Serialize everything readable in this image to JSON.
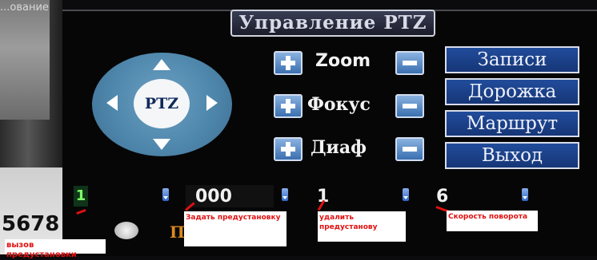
{
  "window": {
    "title": "...ование"
  },
  "left_strip": {
    "number": "5678"
  },
  "panel": {
    "title": "Управление PTZ",
    "joystick": {
      "center_label": "PTZ"
    },
    "controls": [
      {
        "label": "Zoom"
      },
      {
        "label": "Фокус"
      },
      {
        "label": "Диаф"
      }
    ],
    "menu": [
      {
        "label": "Записи"
      },
      {
        "label": "Дорожка"
      },
      {
        "label": "Маршрут"
      },
      {
        "label": "Выход"
      }
    ],
    "bottom": {
      "preset_call_value": "1",
      "set_preset_value": "000",
      "delete_preset_value": "1",
      "rotation_speed_value": "6",
      "partial_label": "П"
    }
  },
  "annotations": {
    "call_preset": "вызов предустановки",
    "set_preset": "Задать предустановку",
    "delete_preset": "удалить предустанову",
    "rotation_speed": "Скорость поворота"
  },
  "colors": {
    "accent_blue": "#1f4a98",
    "annotation_red": "#e01010",
    "preset_green": "#7dff68"
  }
}
